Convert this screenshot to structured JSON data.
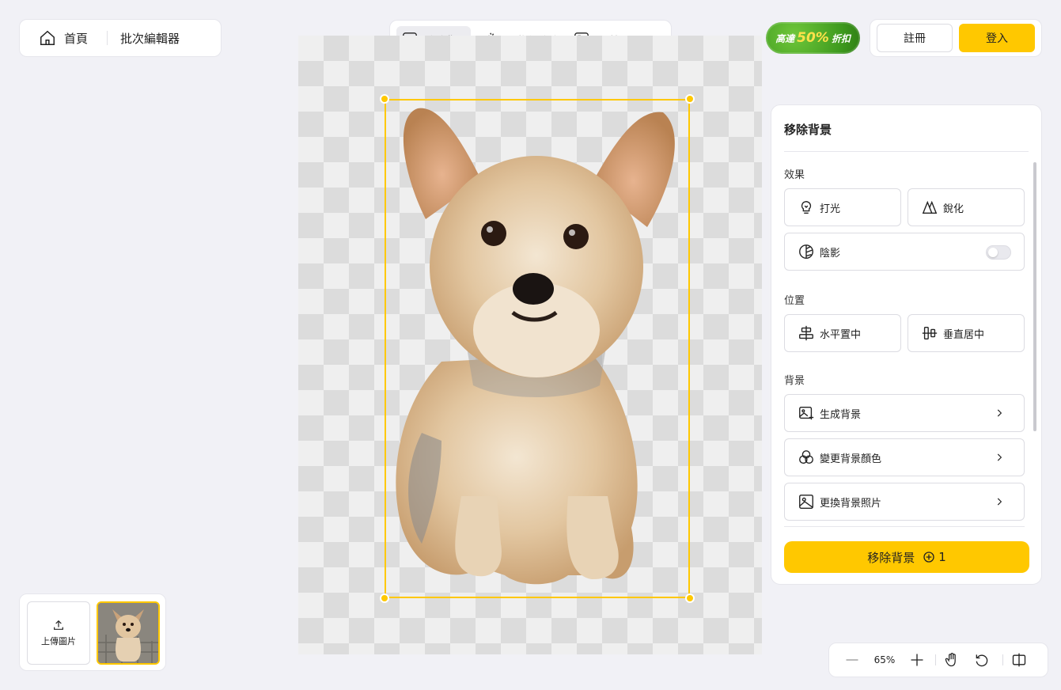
{
  "nav": {
    "home_label": "首頁",
    "batch_label": "批次編輯器"
  },
  "tools": [
    {
      "label": "移除背景",
      "icon": "ai-box-icon",
      "active": true
    },
    {
      "label": "AI 物件移除",
      "icon": "eraser-icon",
      "active": false
    },
    {
      "label": "AI 擴圖工具",
      "icon": "expand-icon",
      "active": false
    }
  ],
  "promo": {
    "prefix": "高達",
    "discount": "50%",
    "suffix": "折扣"
  },
  "auth": {
    "register_label": "註冊",
    "login_label": "登入"
  },
  "panel": {
    "title": "移除背景",
    "effects_heading": "效果",
    "lighting_label": "打光",
    "sharpen_label": "銳化",
    "shadow_label": "陰影",
    "shadow_enabled": false,
    "position_heading": "位置",
    "h_center_label": "水平置中",
    "v_center_label": "垂直居中",
    "background_heading": "背景",
    "generate_bg_label": "生成背景",
    "change_color_label": "變更背景顏色",
    "replace_photo_label": "更換背景照片",
    "cta_label": "移除背景",
    "cta_credits": "1"
  },
  "uploads": {
    "upload_label": "上傳圖片"
  },
  "zoom": {
    "level": "65%"
  },
  "colors": {
    "accent": "#ffc800",
    "promo_green": "#3e9a1e"
  }
}
